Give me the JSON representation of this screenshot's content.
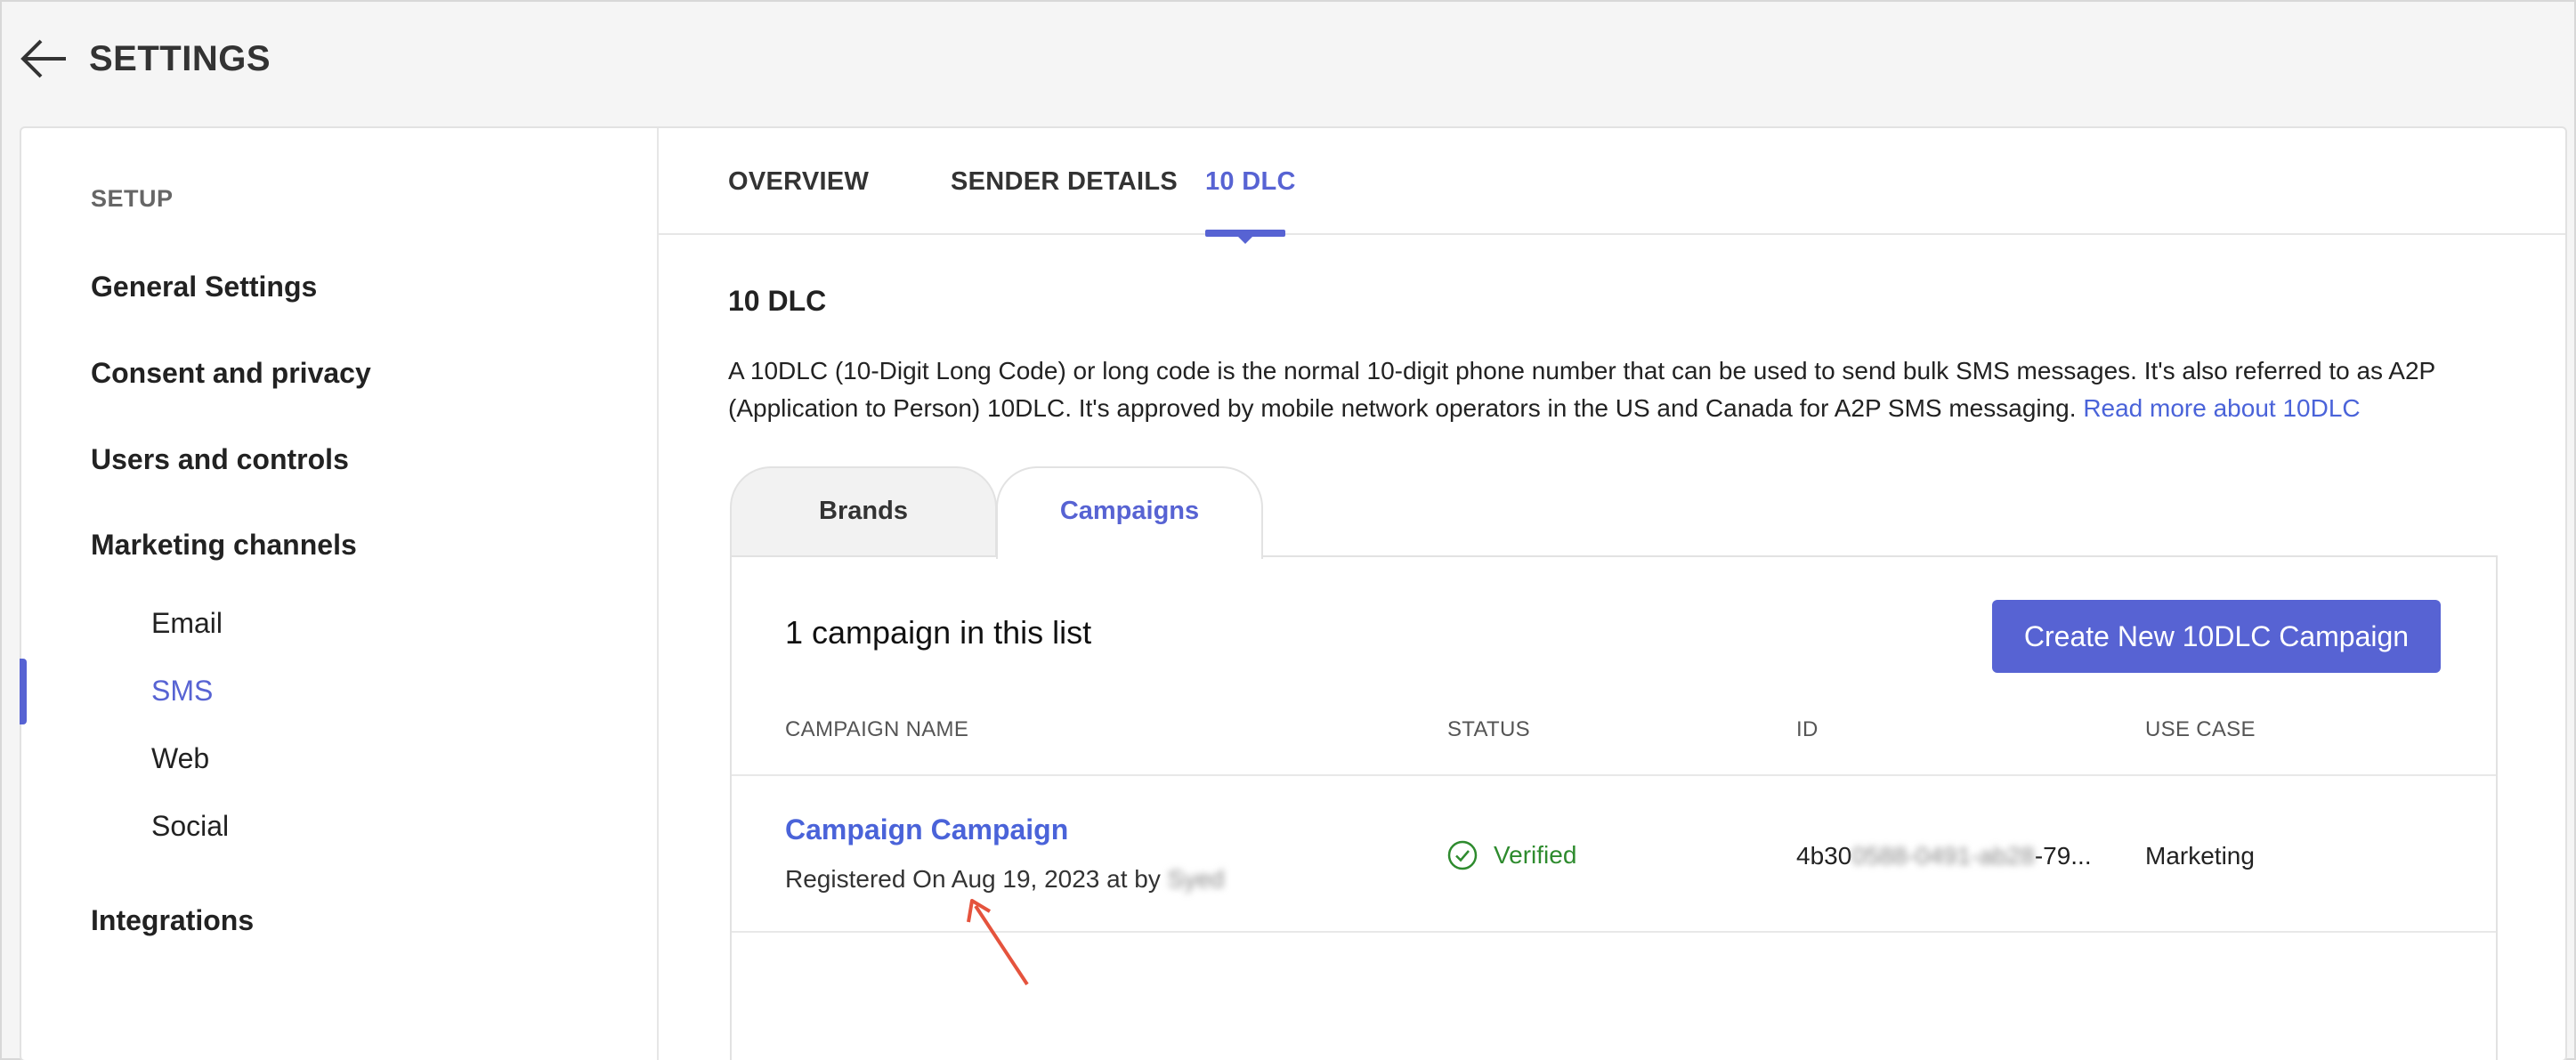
{
  "header": {
    "title": "SETTINGS"
  },
  "sidebar": {
    "heading": "SETUP",
    "items": [
      {
        "label": "General Settings"
      },
      {
        "label": "Consent and privacy"
      },
      {
        "label": "Users and controls"
      },
      {
        "label": "Marketing channels"
      },
      {
        "label": "Email"
      },
      {
        "label": "SMS"
      },
      {
        "label": "Web"
      },
      {
        "label": "Social"
      },
      {
        "label": "Integrations"
      }
    ],
    "active_item": "SMS"
  },
  "tabs": [
    {
      "label": "OVERVIEW"
    },
    {
      "label": "SENDER DETAILS"
    },
    {
      "label": "10 DLC"
    }
  ],
  "active_tab": "10 DLC",
  "section": {
    "title": "10 DLC",
    "description": "A 10DLC (10-Digit Long Code) or long code is the normal 10-digit phone number that can be used to send bulk SMS messages. It's also referred to as A2P (Application to Person) 10DLC. It's approved by mobile network operators in the US and Canada for A2P SMS messaging.",
    "read_more": "Read more about 10DLC"
  },
  "sub_tabs": [
    {
      "label": "Brands"
    },
    {
      "label": "Campaigns"
    }
  ],
  "active_sub_tab": "Campaigns",
  "campaigns": {
    "count_text": "1 campaign in this list",
    "create_button": "Create New 10DLC Campaign",
    "columns": [
      "CAMPAIGN NAME",
      "STATUS",
      "ID",
      "USE CASE"
    ],
    "rows": [
      {
        "name": "Campaign Campaign",
        "registered": "Registered On Aug 19, 2023 at by",
        "registered_by_blurred": "Syed",
        "status": "Verified",
        "id_start": "4b30",
        "id_blurred": "0588-0491-ab28",
        "id_end": "-79...",
        "use_case": "Marketing"
      }
    ]
  },
  "colors": {
    "accent": "#5763d3",
    "link": "#4a63d9",
    "verified": "#2e8b2e",
    "annotation": "#e5533d"
  }
}
